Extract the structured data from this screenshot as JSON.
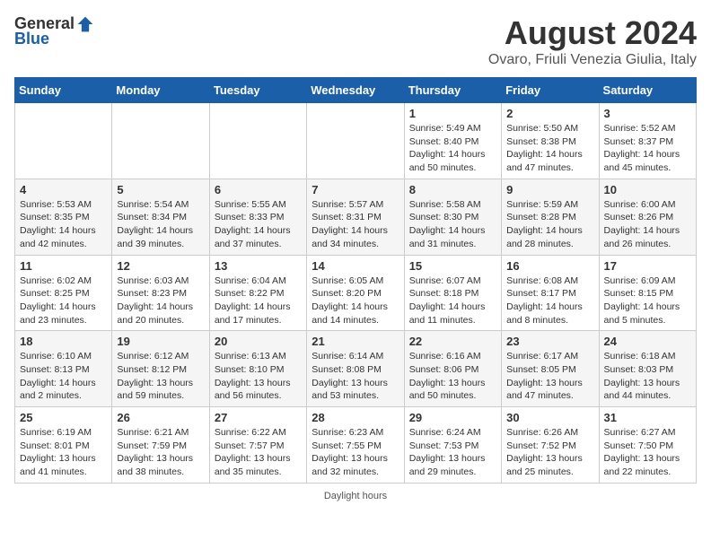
{
  "header": {
    "logo_general": "General",
    "logo_blue": "Blue",
    "title": "August 2024",
    "subtitle": "Ovaro, Friuli Venezia Giulia, Italy"
  },
  "days_of_week": [
    "Sunday",
    "Monday",
    "Tuesday",
    "Wednesday",
    "Thursday",
    "Friday",
    "Saturday"
  ],
  "footer": "Daylight hours",
  "weeks": [
    [
      {
        "day": "",
        "sunrise": "",
        "sunset": "",
        "daylight": ""
      },
      {
        "day": "",
        "sunrise": "",
        "sunset": "",
        "daylight": ""
      },
      {
        "day": "",
        "sunrise": "",
        "sunset": "",
        "daylight": ""
      },
      {
        "day": "",
        "sunrise": "",
        "sunset": "",
        "daylight": ""
      },
      {
        "day": "1",
        "sunrise": "Sunrise: 5:49 AM",
        "sunset": "Sunset: 8:40 PM",
        "daylight": "Daylight: 14 hours and 50 minutes."
      },
      {
        "day": "2",
        "sunrise": "Sunrise: 5:50 AM",
        "sunset": "Sunset: 8:38 PM",
        "daylight": "Daylight: 14 hours and 47 minutes."
      },
      {
        "day": "3",
        "sunrise": "Sunrise: 5:52 AM",
        "sunset": "Sunset: 8:37 PM",
        "daylight": "Daylight: 14 hours and 45 minutes."
      }
    ],
    [
      {
        "day": "4",
        "sunrise": "Sunrise: 5:53 AM",
        "sunset": "Sunset: 8:35 PM",
        "daylight": "Daylight: 14 hours and 42 minutes."
      },
      {
        "day": "5",
        "sunrise": "Sunrise: 5:54 AM",
        "sunset": "Sunset: 8:34 PM",
        "daylight": "Daylight: 14 hours and 39 minutes."
      },
      {
        "day": "6",
        "sunrise": "Sunrise: 5:55 AM",
        "sunset": "Sunset: 8:33 PM",
        "daylight": "Daylight: 14 hours and 37 minutes."
      },
      {
        "day": "7",
        "sunrise": "Sunrise: 5:57 AM",
        "sunset": "Sunset: 8:31 PM",
        "daylight": "Daylight: 14 hours and 34 minutes."
      },
      {
        "day": "8",
        "sunrise": "Sunrise: 5:58 AM",
        "sunset": "Sunset: 8:30 PM",
        "daylight": "Daylight: 14 hours and 31 minutes."
      },
      {
        "day": "9",
        "sunrise": "Sunrise: 5:59 AM",
        "sunset": "Sunset: 8:28 PM",
        "daylight": "Daylight: 14 hours and 28 minutes."
      },
      {
        "day": "10",
        "sunrise": "Sunrise: 6:00 AM",
        "sunset": "Sunset: 8:26 PM",
        "daylight": "Daylight: 14 hours and 26 minutes."
      }
    ],
    [
      {
        "day": "11",
        "sunrise": "Sunrise: 6:02 AM",
        "sunset": "Sunset: 8:25 PM",
        "daylight": "Daylight: 14 hours and 23 minutes."
      },
      {
        "day": "12",
        "sunrise": "Sunrise: 6:03 AM",
        "sunset": "Sunset: 8:23 PM",
        "daylight": "Daylight: 14 hours and 20 minutes."
      },
      {
        "day": "13",
        "sunrise": "Sunrise: 6:04 AM",
        "sunset": "Sunset: 8:22 PM",
        "daylight": "Daylight: 14 hours and 17 minutes."
      },
      {
        "day": "14",
        "sunrise": "Sunrise: 6:05 AM",
        "sunset": "Sunset: 8:20 PM",
        "daylight": "Daylight: 14 hours and 14 minutes."
      },
      {
        "day": "15",
        "sunrise": "Sunrise: 6:07 AM",
        "sunset": "Sunset: 8:18 PM",
        "daylight": "Daylight: 14 hours and 11 minutes."
      },
      {
        "day": "16",
        "sunrise": "Sunrise: 6:08 AM",
        "sunset": "Sunset: 8:17 PM",
        "daylight": "Daylight: 14 hours and 8 minutes."
      },
      {
        "day": "17",
        "sunrise": "Sunrise: 6:09 AM",
        "sunset": "Sunset: 8:15 PM",
        "daylight": "Daylight: 14 hours and 5 minutes."
      }
    ],
    [
      {
        "day": "18",
        "sunrise": "Sunrise: 6:10 AM",
        "sunset": "Sunset: 8:13 PM",
        "daylight": "Daylight: 14 hours and 2 minutes."
      },
      {
        "day": "19",
        "sunrise": "Sunrise: 6:12 AM",
        "sunset": "Sunset: 8:12 PM",
        "daylight": "Daylight: 13 hours and 59 minutes."
      },
      {
        "day": "20",
        "sunrise": "Sunrise: 6:13 AM",
        "sunset": "Sunset: 8:10 PM",
        "daylight": "Daylight: 13 hours and 56 minutes."
      },
      {
        "day": "21",
        "sunrise": "Sunrise: 6:14 AM",
        "sunset": "Sunset: 8:08 PM",
        "daylight": "Daylight: 13 hours and 53 minutes."
      },
      {
        "day": "22",
        "sunrise": "Sunrise: 6:16 AM",
        "sunset": "Sunset: 8:06 PM",
        "daylight": "Daylight: 13 hours and 50 minutes."
      },
      {
        "day": "23",
        "sunrise": "Sunrise: 6:17 AM",
        "sunset": "Sunset: 8:05 PM",
        "daylight": "Daylight: 13 hours and 47 minutes."
      },
      {
        "day": "24",
        "sunrise": "Sunrise: 6:18 AM",
        "sunset": "Sunset: 8:03 PM",
        "daylight": "Daylight: 13 hours and 44 minutes."
      }
    ],
    [
      {
        "day": "25",
        "sunrise": "Sunrise: 6:19 AM",
        "sunset": "Sunset: 8:01 PM",
        "daylight": "Daylight: 13 hours and 41 minutes."
      },
      {
        "day": "26",
        "sunrise": "Sunrise: 6:21 AM",
        "sunset": "Sunset: 7:59 PM",
        "daylight": "Daylight: 13 hours and 38 minutes."
      },
      {
        "day": "27",
        "sunrise": "Sunrise: 6:22 AM",
        "sunset": "Sunset: 7:57 PM",
        "daylight": "Daylight: 13 hours and 35 minutes."
      },
      {
        "day": "28",
        "sunrise": "Sunrise: 6:23 AM",
        "sunset": "Sunset: 7:55 PM",
        "daylight": "Daylight: 13 hours and 32 minutes."
      },
      {
        "day": "29",
        "sunrise": "Sunrise: 6:24 AM",
        "sunset": "Sunset: 7:53 PM",
        "daylight": "Daylight: 13 hours and 29 minutes."
      },
      {
        "day": "30",
        "sunrise": "Sunrise: 6:26 AM",
        "sunset": "Sunset: 7:52 PM",
        "daylight": "Daylight: 13 hours and 25 minutes."
      },
      {
        "day": "31",
        "sunrise": "Sunrise: 6:27 AM",
        "sunset": "Sunset: 7:50 PM",
        "daylight": "Daylight: 13 hours and 22 minutes."
      }
    ]
  ]
}
